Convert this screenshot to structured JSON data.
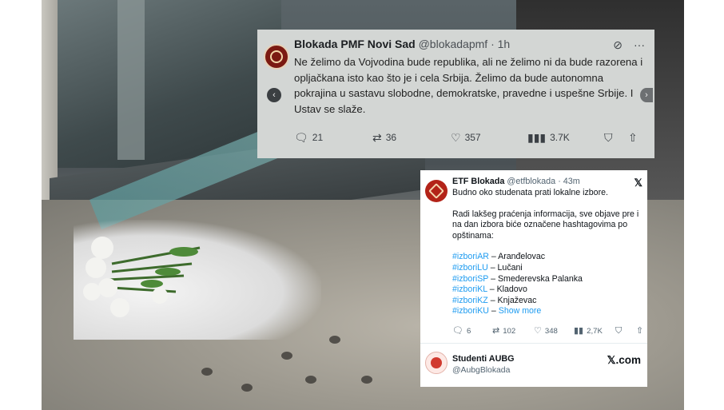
{
  "tweet1": {
    "name": "Blokada PMF Novi Sad",
    "handle": "@blokadapmf",
    "time": "· 1h",
    "text": "Ne želimo da Vojvodina bude republika, ali ne želimo ni da bude razorena i opljačkana isto kao što je i cela Srbija. Želimo da bude autonomna pokrajina u sastavu slobodne, demokratske, pravedne i uspešne Srbije. I Ustav se slaže.",
    "replies": "21",
    "reposts": "36",
    "likes": "357",
    "views": "3.7K",
    "icons": [
      "grok-icon",
      "more-icon",
      "reply-icon",
      "repost-icon",
      "like-icon",
      "views-icon",
      "bookmark-icon",
      "share-icon"
    ]
  },
  "tweet2": {
    "name": "ETF Blokada",
    "handle": "@etfblokada",
    "time": "· 43m",
    "line1": "Budno oko studenata prati lokalne izbore.",
    "para2": "Radi lakšeg praćenja informacija, sve objave pre i na dan izbora biće označene hashtagovima po opštinama:",
    "hashtags": [
      {
        "tag": "#izboriAR",
        "place": "– Aranđelovac"
      },
      {
        "tag": "#izboriLU",
        "place": "– Lučani"
      },
      {
        "tag": "#izboriSP",
        "place": "– Smederevska Palanka"
      },
      {
        "tag": "#izboriKL",
        "place": "– Kladovo"
      },
      {
        "tag": "#izboriKZ",
        "place": "– Knjaževac"
      },
      {
        "tag": "#izboriKU",
        "place": "–"
      }
    ],
    "show_more": "Show more",
    "replies": "6",
    "reposts": "102",
    "likes": "348",
    "views": "2,7K",
    "accent": "#1d9bf0"
  },
  "card": {
    "name": "Studenti AUBG",
    "handle": "@AubgBlokada",
    "site": "𝕏.com"
  }
}
